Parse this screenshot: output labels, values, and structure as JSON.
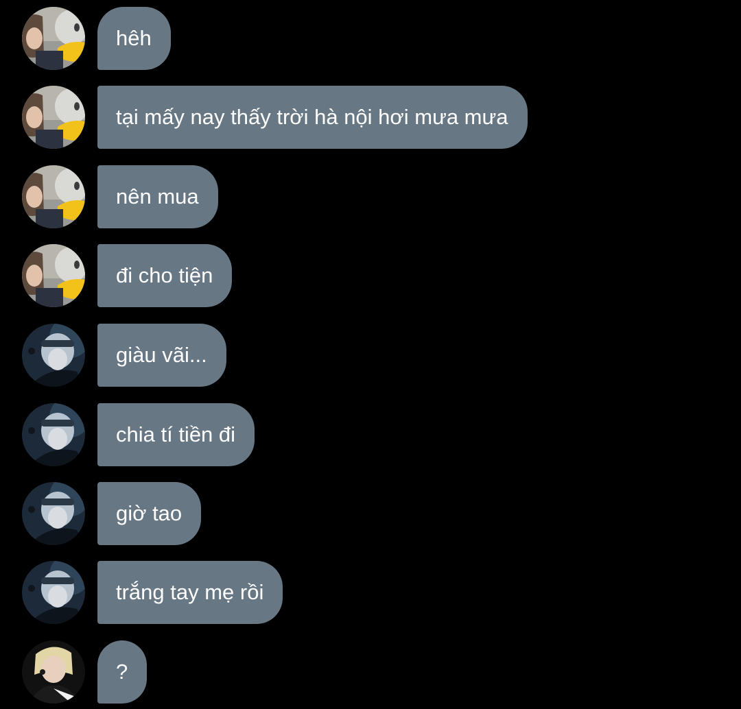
{
  "conversation": {
    "messages": [
      {
        "text": "hêh",
        "avatar": "duck-person-avatar"
      },
      {
        "text": "tại mấy nay thấy trời hà nội hơi mưa mưa",
        "avatar": "duck-person-avatar"
      },
      {
        "text": "nên mua",
        "avatar": "duck-person-avatar"
      },
      {
        "text": "đi cho tiện",
        "avatar": "duck-person-avatar"
      },
      {
        "text": "giàu vãi...",
        "avatar": "headband-singer-avatar"
      },
      {
        "text": "chia tí tiền đi",
        "avatar": "headband-singer-avatar"
      },
      {
        "text": "giờ tao",
        "avatar": "headband-singer-avatar"
      },
      {
        "text": "trắng tay mẹ rồi",
        "avatar": "headband-singer-avatar"
      },
      {
        "text": "?",
        "avatar": "blonde-person-avatar"
      }
    ]
  },
  "colors": {
    "background": "#000000",
    "bubble": "#687784",
    "text": "#ffffff"
  }
}
